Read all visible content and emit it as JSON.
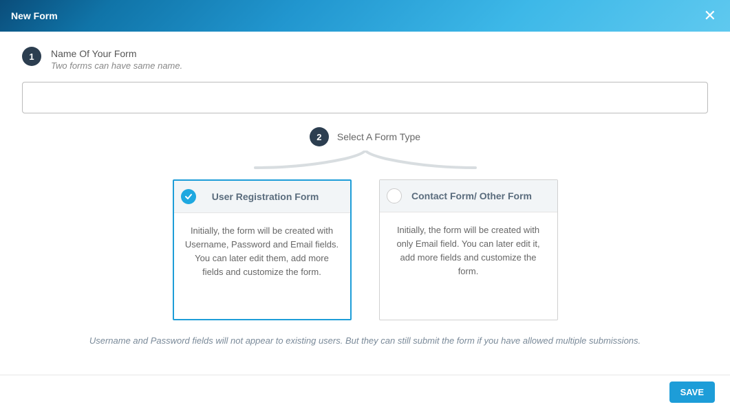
{
  "header": {
    "title": "New Form"
  },
  "step1": {
    "number": "1",
    "label": "Name Of Your Form",
    "hint": "Two forms can have same name.",
    "value": ""
  },
  "step2": {
    "number": "2",
    "label": "Select A Form Type"
  },
  "cards": [
    {
      "title": "User Registration Form",
      "desc": "Initially, the form will be created with Username, Password and Email fields. You can later edit them, add more fields and customize the form.",
      "selected": true
    },
    {
      "title": "Contact Form/ Other Form",
      "desc": "Initially, the form will be created with only Email field. You can later edit it, add more fields and customize the form.",
      "selected": false
    }
  ],
  "note": "Username and Password fields will not appear to existing users. But they can still submit the form if you have allowed multiple submissions.",
  "footer": {
    "save": "SAVE"
  }
}
